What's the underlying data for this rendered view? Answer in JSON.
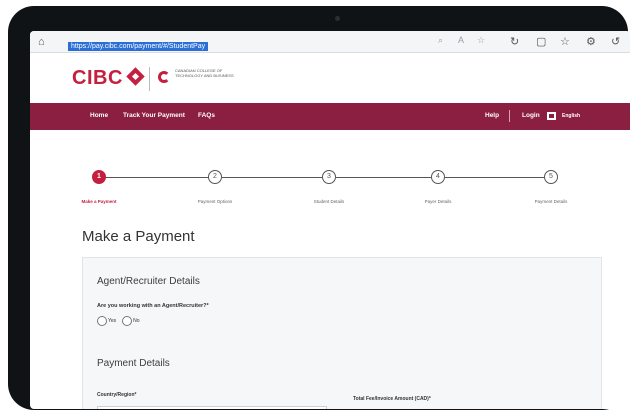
{
  "browser": {
    "url": "https://pay.cibc.com/payment/#/StudentPay",
    "back_glyph": "⌂",
    "right_icons": [
      "↻",
      "▢",
      "☆",
      "⚙",
      "↺"
    ]
  },
  "brand": {
    "logo_text": "CIBC",
    "college_text": "CANADIAN COLLEGE OF TECHNOLOGY AND BUSINESS"
  },
  "nav": {
    "home": "Home",
    "track": "Track Your Payment",
    "faqs": "FAQs",
    "help": "Help",
    "login": "Login",
    "language": "English"
  },
  "stepper": {
    "steps": [
      {
        "number": "1",
        "label": "Make a Payment",
        "active": true
      },
      {
        "number": "2",
        "label": "Payment Options",
        "active": false
      },
      {
        "number": "3",
        "label": "Student Details",
        "active": false
      },
      {
        "number": "4",
        "label": "Payer Details",
        "active": false
      },
      {
        "number": "5",
        "label": "Payment Details",
        "active": false
      }
    ]
  },
  "page": {
    "title": "Make a Payment"
  },
  "agent_section": {
    "title": "Agent/Recruiter Details",
    "question": "Are you working with an Agent/Recruiter?*",
    "options": [
      "Yes",
      "No"
    ]
  },
  "payment_section": {
    "title": "Payment Details",
    "country_label": "Country/Region*",
    "amount_label": "Total Fee/Invoice Amount (CAD)*"
  },
  "colors": {
    "brand_red": "#c41f3e",
    "nav_maroon": "#8b1f41"
  }
}
